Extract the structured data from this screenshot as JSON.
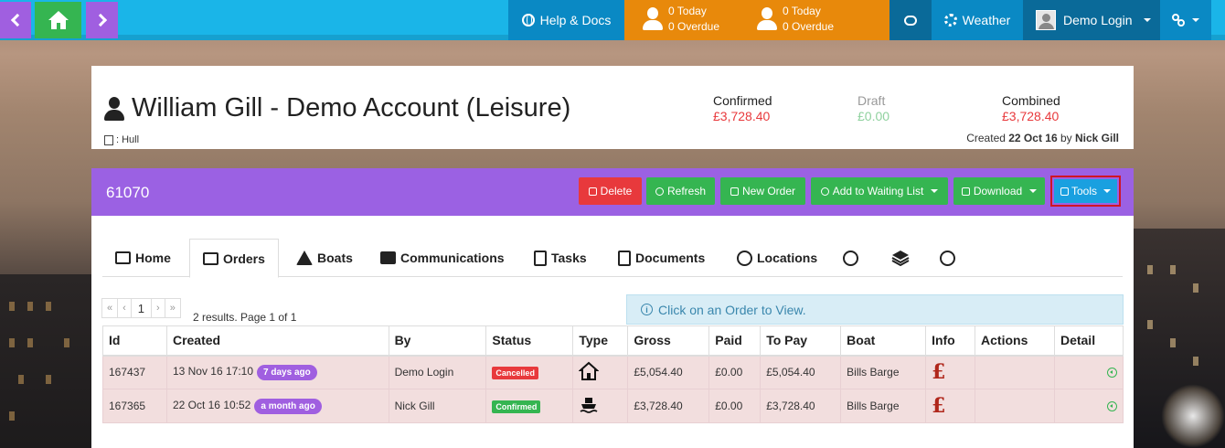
{
  "topbar": {
    "help_label": "Help & Docs",
    "tasks_counter": {
      "today": "0 Today",
      "overdue": "0 Overdue"
    },
    "alerts_counter": {
      "today": "0 Today",
      "overdue": "0 Overdue"
    },
    "weather_label": "Weather",
    "user_label": "Demo Login",
    "colors": {
      "bar": "#1ab5e8",
      "nav_purple": "#a05fe0",
      "home_green": "#35b551",
      "counter_orange": "#e8890b"
    }
  },
  "header": {
    "account_title": "William Gill - Demo Account (Leisure)",
    "location": ": Hull",
    "confirmed": {
      "label": "Confirmed",
      "value": "£3,728.40",
      "color": "#e8393c"
    },
    "draft": {
      "label": "Draft",
      "value": "£0.00",
      "label_color": "#999999",
      "color": "#8fd19e"
    },
    "combined": {
      "label": "Combined",
      "value": "£3,728.40",
      "color": "#e8393c"
    },
    "created_prefix": "Created ",
    "created_date": "22 Oct 16",
    "created_by_prefix": " by ",
    "created_by": "Nick Gill"
  },
  "order_bar": {
    "order_id": "61070",
    "buttons": {
      "delete": "Delete",
      "refresh": "Refresh",
      "new_order": "New Order",
      "waiting_list": "Add to Waiting List",
      "download": "Download",
      "tools": "Tools"
    }
  },
  "tabs": {
    "home": "Home",
    "orders": "Orders",
    "boats": "Boats",
    "communications": "Communications",
    "tasks": "Tasks",
    "documents": "Documents",
    "locations": "Locations"
  },
  "pager": {
    "first": "«",
    "prev": "‹",
    "current": "1",
    "next": "›",
    "last": "»",
    "info": "2 results. Page 1 of 1"
  },
  "info_message": "Click on an Order to View.",
  "table": {
    "headers": [
      "Id",
      "Created",
      "By",
      "Status",
      "Type",
      "Gross",
      "Paid",
      "To Pay",
      "Boat",
      "Info",
      "Actions",
      "Detail"
    ],
    "rows": [
      {
        "id": "167437",
        "created": "13 Nov 16 17:10",
        "ago": "7 days ago",
        "by": "Demo Login",
        "status": "Cancelled",
        "type": "house-icon",
        "gross": "£5,054.40",
        "paid": "£0.00",
        "to_pay": "£5,054.40",
        "boat": "Bills Barge",
        "info": "£"
      },
      {
        "id": "167365",
        "created": "22 Oct 16 10:52",
        "ago": "a month ago",
        "by": "Nick Gill",
        "status": "Confirmed",
        "type": "boat-icon",
        "gross": "£3,728.40",
        "paid": "£0.00",
        "to_pay": "£3,728.40",
        "boat": "Bills Barge",
        "info": "£"
      }
    ]
  }
}
